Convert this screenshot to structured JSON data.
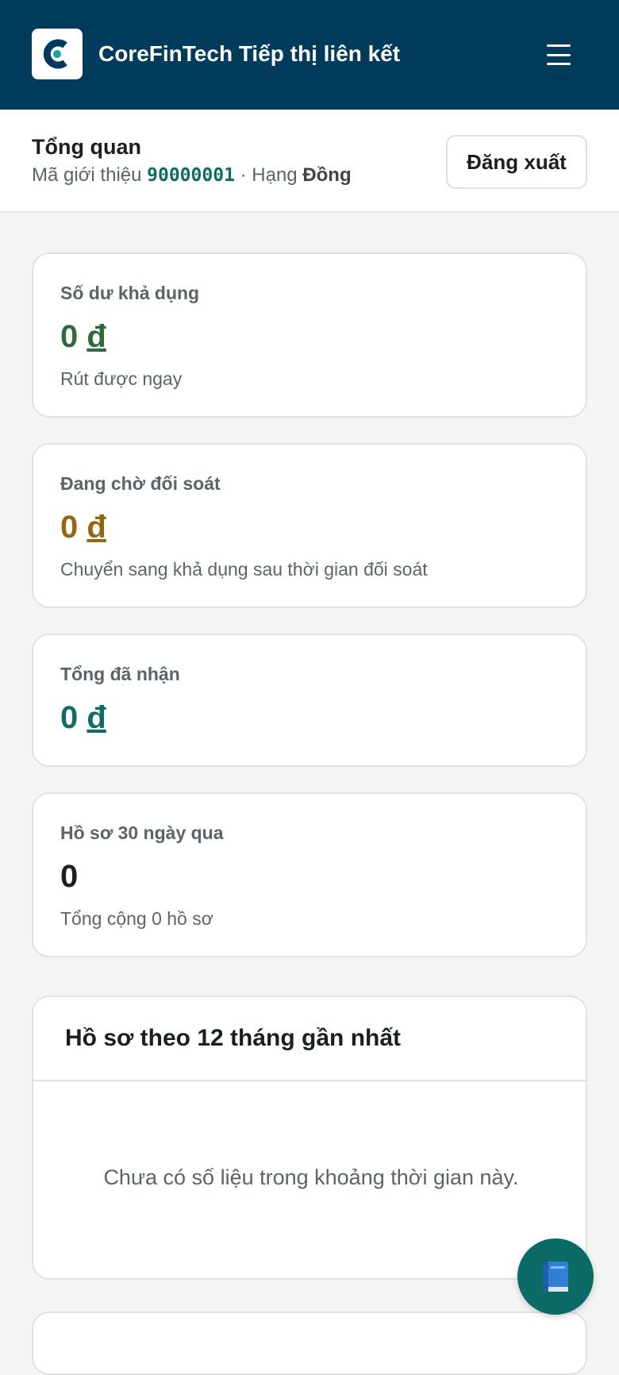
{
  "header": {
    "app_title": "CoreFinTech Tiếp thị liên kết",
    "logo_icon": "corefintech-logo-icon",
    "menu_icon": "hamburger-menu-icon",
    "background_color": "#003b5c"
  },
  "overview": {
    "title": "Tổng quan",
    "referral_label": "Mã giới thiệu",
    "referral_code": "90000001",
    "separator": "·",
    "rank_label": "Hạng",
    "rank_value": "Đồng",
    "logout_label": "Đăng xuất"
  },
  "stats": [
    {
      "label": "Số dư khả dụng",
      "amount": "0",
      "currency": "đ",
      "note": "Rút được ngay",
      "color": "#2e6b3a"
    },
    {
      "label": "Đang chờ đối soát",
      "amount": "0",
      "currency": "đ",
      "note": "Chuyển sang khả dụng sau thời gian đối soát",
      "color": "#956612"
    },
    {
      "label": "Tổng đã nhận",
      "amount": "0",
      "currency": "đ",
      "note": "",
      "color": "#0f6b66"
    },
    {
      "label": "Hồ sơ 30 ngày qua",
      "amount": "0",
      "currency": "",
      "note": "Tổng cộng 0 hồ sơ",
      "color": "#1a1f22"
    }
  ],
  "monthly_chart": {
    "title": "Hồ sơ theo 12 tháng gần nhất",
    "empty_message": "Chưa có số liệu trong khoảng thời gian này."
  },
  "fab": {
    "icon": "book-icon",
    "color": "#0a6b66"
  }
}
